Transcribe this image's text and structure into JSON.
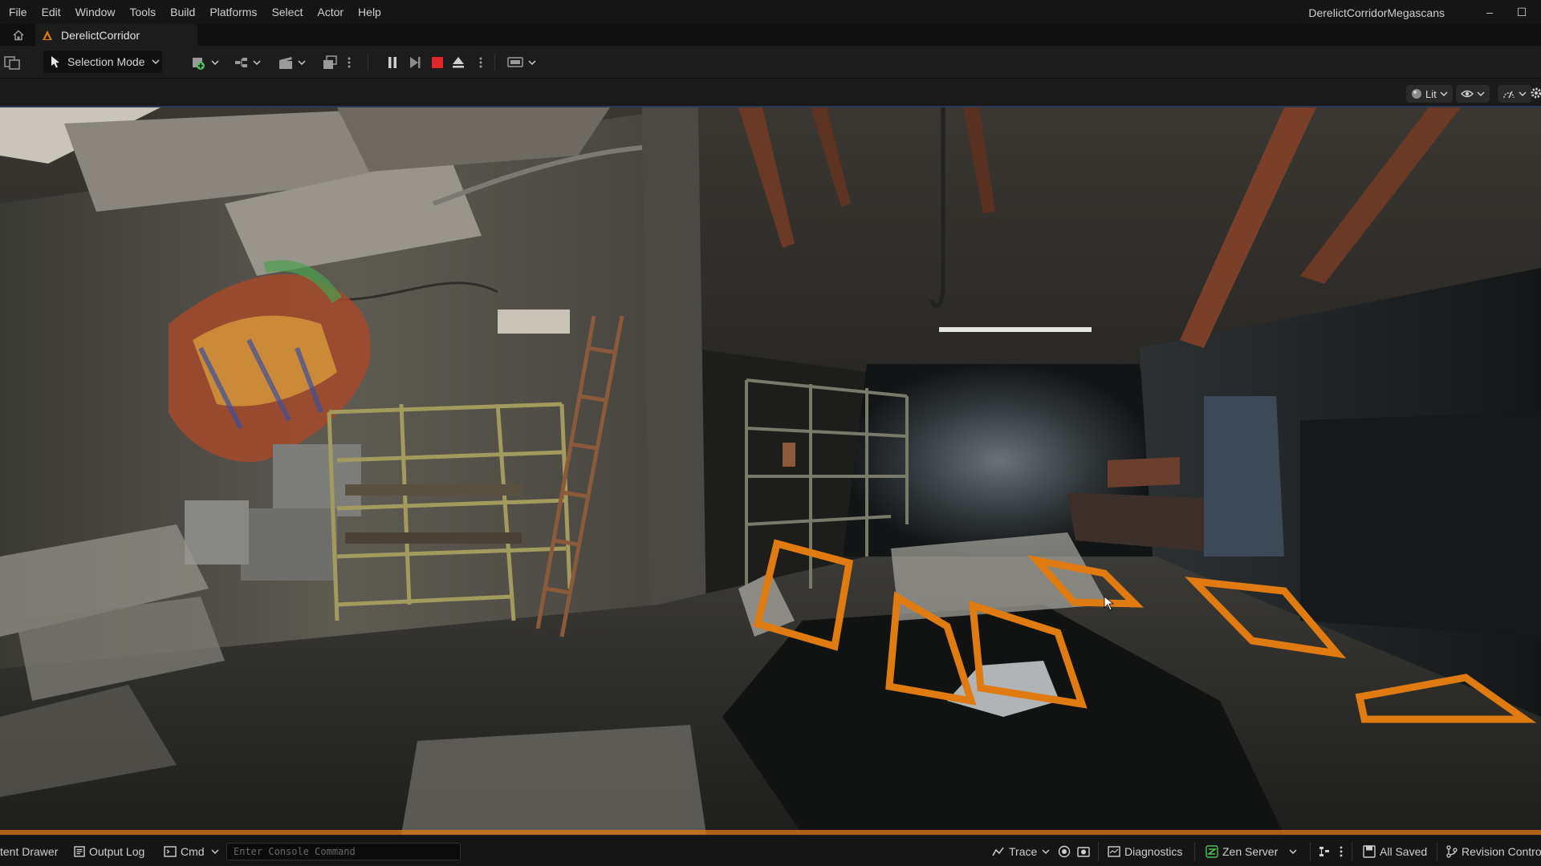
{
  "menu": {
    "items": [
      "File",
      "Edit",
      "Window",
      "Tools",
      "Build",
      "Platforms",
      "Select",
      "Actor",
      "Help"
    ]
  },
  "window": {
    "project_name": "DerelictCorridorMegascans",
    "minimize_glyph": "–",
    "maximize_glyph": "☐"
  },
  "tab": {
    "label": "DerelictCorridor"
  },
  "toolbar": {
    "selection_mode_label": "Selection Mode"
  },
  "viewport": {
    "view_mode_label": "Lit"
  },
  "statusbar": {
    "content_drawer_label": "tent Drawer",
    "output_log_label": "Output Log",
    "cmd_label": "Cmd",
    "console_placeholder": "Enter Console Command",
    "trace_label": "Trace",
    "diagnostics_label": "Diagnostics",
    "zen_server_label": "Zen Server",
    "all_saved_label": "All Saved",
    "revision_control_label": "Revision Contro"
  },
  "colors": {
    "accent_orange": "#e07b12",
    "stop_red": "#e0262b",
    "zen_green": "#4fbf5a"
  }
}
